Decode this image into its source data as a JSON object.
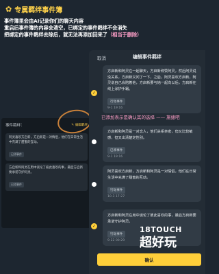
{
  "header": {
    "star": "✿",
    "title": "专属羁绊事件簿"
  },
  "intro": {
    "line1": "事件簿里会由AI记录你们的聊天内容",
    "line2": "重启后事件簿的内容会清空，已绑定的事件羁绊不会消失",
    "line3a": "把绑定的事件羁绊去除后，就无法再添加回来了",
    "line3b": "（相当于删除）"
  },
  "back": {
    "title": "事件羁绊：",
    "edit": "编辑羁绊",
    "cards": [
      {
        "text": "阿灵喜欢方启新，方启新是一对情侣，他们在日常生活中充满了甜蜜的互动。",
        "tag": "已添事件"
      },
      {
        "text": "方启新和阿灵在用中谈论了彼此喜欢的事，最后方启新要承诺守护阿灵。",
        "tag": "已添事件"
      }
    ]
  },
  "modal": {
    "cancel": "取消",
    "title": "编辑事件羁绊",
    "confirm": "确认",
    "cards": [
      {
        "text": "方启新和阿灵在一起聊天，方启新称赞阿灵，然后阿灵说没关系，方启新又问了一下，之后，阿灵喜欢方启新，阿灵说自己会陪着他，方启新要与她一起向以后，方启新在线上涂护手霜。",
        "tag": "行动事件",
        "date": "9-1 19:16"
      },
      {
        "text": "方启新和阿灵是一对恋人，他们关系亲密，但又比较敏感，但又出清楚定性别。",
        "tag": "已添事件",
        "date": "9-1 19:16"
      },
      {
        "text": "阿灵喜欢方启新，方启新和阿灵是一对情侣，他们在日常生活中充满了甜蜜的互动。",
        "tag": "行动事件",
        "date": "10-3 17:27"
      },
      {
        "text": "方启新和阿灵在用中谈论了彼此喜欢的事，最后方启新要承诺守护阿灵。",
        "tag": "行动事件",
        "date": "9-22 00:29"
      }
    ]
  },
  "annotation": "已添加表示是确认其的选择 —— 施捷吧",
  "watermark": {
    "top": "18TOUCH",
    "bottom": "超好玩"
  },
  "colors": {
    "accent": "#ffcf3a",
    "bg": "#1d2630",
    "pink": "#ff9fc8"
  }
}
